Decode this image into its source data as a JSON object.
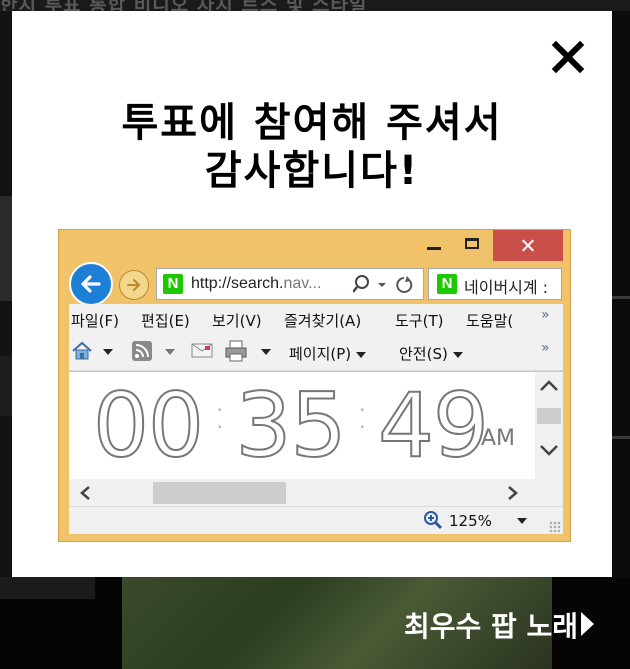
{
  "background": {
    "top_strip_text": "한지 투표 통합 비디오 차지 트스 및 스타일",
    "bottom_caption": "최우수 팝 노래"
  },
  "modal": {
    "title_line1": "투표에 참여해 주셔서",
    "title_line2": "감사합니다!",
    "close_icon": "close-icon"
  },
  "browser": {
    "address_text": "http://search.",
    "address_text_dim": "nav...",
    "tab_label": "네이버시계 :",
    "menu": [
      "파일(F)",
      "편집(E)",
      "보기(V)",
      "즐겨찾기(A)",
      "도구(T)",
      "도움말("
    ],
    "menu_more": "»",
    "commands": {
      "page": "페이지(P)",
      "safety": "안전(S)"
    },
    "clock": {
      "hours": "00",
      "minutes": "35",
      "seconds": "49",
      "ampm": "AM"
    },
    "zoom": "125%",
    "colors": {
      "frame": "#f0c36a",
      "close_button": "#c9504a",
      "back_button": "#1e7fd6",
      "naver_green": "#1ec800"
    }
  }
}
